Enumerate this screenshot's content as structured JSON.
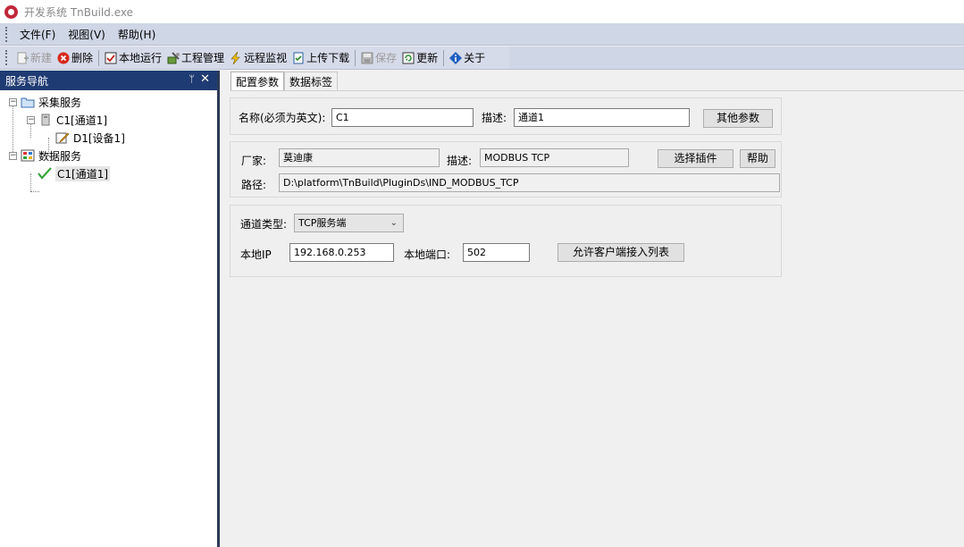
{
  "window": {
    "title": "开发系统 TnBuild.exe"
  },
  "menu": {
    "items": [
      "文件(F)",
      "视图(V)",
      "帮助(H)"
    ]
  },
  "toolbar": {
    "new": "新建",
    "delete": "删除",
    "local_run": "本地运行",
    "project_manage": "工程管理",
    "remote_monitor": "远程监视",
    "upload_download": "上传下载",
    "save": "保存",
    "update": "更新",
    "about": "关于"
  },
  "nav": {
    "title": "服务导航",
    "pin": "ᛘ",
    "close": "✕",
    "tree": {
      "collect_service": "采集服务",
      "c1_channel": "C1[通道1]",
      "d1_device": "D1[设备1]",
      "data_service": "数据服务",
      "c1_channel_data": "C1[通道1]"
    }
  },
  "tabs": {
    "config": "配置参数",
    "data_tags": "数据标签"
  },
  "group1": {
    "name_label": "名称(必须为英文):",
    "name_value": "C1",
    "desc_label": "描述:",
    "desc_value": "通道1",
    "other_params": "其他参数"
  },
  "group2": {
    "vendor_label": "厂家:",
    "vendor_value": "莫迪康",
    "desc_label": "描述:",
    "desc_value": "MODBUS TCP",
    "choose_plugin": "选择插件",
    "help": "帮助",
    "path_label": "路径:",
    "path_value": "D:\\platform\\TnBuild\\PluginDs\\IND_MODBUS_TCP"
  },
  "group3": {
    "channel_type_label": "通道类型:",
    "channel_type_value": "TCP服务端",
    "local_ip_label": "本地IP",
    "local_ip_value": "192.168.0.253",
    "local_port_label": "本地端口:",
    "local_port_value": "502",
    "allow_clients": "允许客户端接入列表"
  }
}
